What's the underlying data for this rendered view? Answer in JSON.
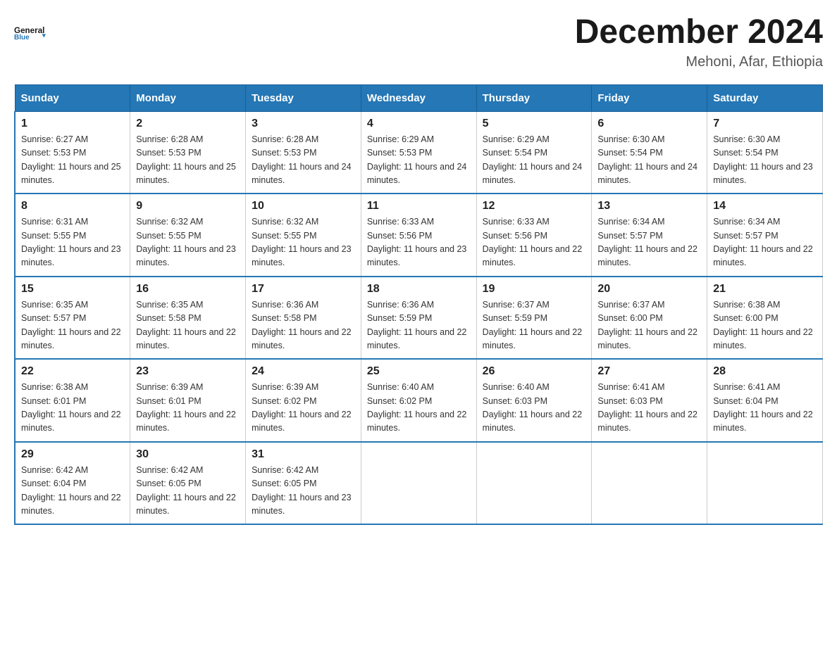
{
  "header": {
    "logo_general": "General",
    "logo_blue": "Blue",
    "month_year": "December 2024",
    "location": "Mehoni, Afar, Ethiopia"
  },
  "weekdays": [
    "Sunday",
    "Monday",
    "Tuesday",
    "Wednesday",
    "Thursday",
    "Friday",
    "Saturday"
  ],
  "weeks": [
    [
      {
        "day": "1",
        "sunrise": "6:27 AM",
        "sunset": "5:53 PM",
        "daylight": "11 hours and 25 minutes."
      },
      {
        "day": "2",
        "sunrise": "6:28 AM",
        "sunset": "5:53 PM",
        "daylight": "11 hours and 25 minutes."
      },
      {
        "day": "3",
        "sunrise": "6:28 AM",
        "sunset": "5:53 PM",
        "daylight": "11 hours and 24 minutes."
      },
      {
        "day": "4",
        "sunrise": "6:29 AM",
        "sunset": "5:53 PM",
        "daylight": "11 hours and 24 minutes."
      },
      {
        "day": "5",
        "sunrise": "6:29 AM",
        "sunset": "5:54 PM",
        "daylight": "11 hours and 24 minutes."
      },
      {
        "day": "6",
        "sunrise": "6:30 AM",
        "sunset": "5:54 PM",
        "daylight": "11 hours and 24 minutes."
      },
      {
        "day": "7",
        "sunrise": "6:30 AM",
        "sunset": "5:54 PM",
        "daylight": "11 hours and 23 minutes."
      }
    ],
    [
      {
        "day": "8",
        "sunrise": "6:31 AM",
        "sunset": "5:55 PM",
        "daylight": "11 hours and 23 minutes."
      },
      {
        "day": "9",
        "sunrise": "6:32 AM",
        "sunset": "5:55 PM",
        "daylight": "11 hours and 23 minutes."
      },
      {
        "day": "10",
        "sunrise": "6:32 AM",
        "sunset": "5:55 PM",
        "daylight": "11 hours and 23 minutes."
      },
      {
        "day": "11",
        "sunrise": "6:33 AM",
        "sunset": "5:56 PM",
        "daylight": "11 hours and 23 minutes."
      },
      {
        "day": "12",
        "sunrise": "6:33 AM",
        "sunset": "5:56 PM",
        "daylight": "11 hours and 22 minutes."
      },
      {
        "day": "13",
        "sunrise": "6:34 AM",
        "sunset": "5:57 PM",
        "daylight": "11 hours and 22 minutes."
      },
      {
        "day": "14",
        "sunrise": "6:34 AM",
        "sunset": "5:57 PM",
        "daylight": "11 hours and 22 minutes."
      }
    ],
    [
      {
        "day": "15",
        "sunrise": "6:35 AM",
        "sunset": "5:57 PM",
        "daylight": "11 hours and 22 minutes."
      },
      {
        "day": "16",
        "sunrise": "6:35 AM",
        "sunset": "5:58 PM",
        "daylight": "11 hours and 22 minutes."
      },
      {
        "day": "17",
        "sunrise": "6:36 AM",
        "sunset": "5:58 PM",
        "daylight": "11 hours and 22 minutes."
      },
      {
        "day": "18",
        "sunrise": "6:36 AM",
        "sunset": "5:59 PM",
        "daylight": "11 hours and 22 minutes."
      },
      {
        "day": "19",
        "sunrise": "6:37 AM",
        "sunset": "5:59 PM",
        "daylight": "11 hours and 22 minutes."
      },
      {
        "day": "20",
        "sunrise": "6:37 AM",
        "sunset": "6:00 PM",
        "daylight": "11 hours and 22 minutes."
      },
      {
        "day": "21",
        "sunrise": "6:38 AM",
        "sunset": "6:00 PM",
        "daylight": "11 hours and 22 minutes."
      }
    ],
    [
      {
        "day": "22",
        "sunrise": "6:38 AM",
        "sunset": "6:01 PM",
        "daylight": "11 hours and 22 minutes."
      },
      {
        "day": "23",
        "sunrise": "6:39 AM",
        "sunset": "6:01 PM",
        "daylight": "11 hours and 22 minutes."
      },
      {
        "day": "24",
        "sunrise": "6:39 AM",
        "sunset": "6:02 PM",
        "daylight": "11 hours and 22 minutes."
      },
      {
        "day": "25",
        "sunrise": "6:40 AM",
        "sunset": "6:02 PM",
        "daylight": "11 hours and 22 minutes."
      },
      {
        "day": "26",
        "sunrise": "6:40 AM",
        "sunset": "6:03 PM",
        "daylight": "11 hours and 22 minutes."
      },
      {
        "day": "27",
        "sunrise": "6:41 AM",
        "sunset": "6:03 PM",
        "daylight": "11 hours and 22 minutes."
      },
      {
        "day": "28",
        "sunrise": "6:41 AM",
        "sunset": "6:04 PM",
        "daylight": "11 hours and 22 minutes."
      }
    ],
    [
      {
        "day": "29",
        "sunrise": "6:42 AM",
        "sunset": "6:04 PM",
        "daylight": "11 hours and 22 minutes."
      },
      {
        "day": "30",
        "sunrise": "6:42 AM",
        "sunset": "6:05 PM",
        "daylight": "11 hours and 22 minutes."
      },
      {
        "day": "31",
        "sunrise": "6:42 AM",
        "sunset": "6:05 PM",
        "daylight": "11 hours and 23 minutes."
      },
      null,
      null,
      null,
      null
    ]
  ],
  "labels": {
    "sunrise": "Sunrise:",
    "sunset": "Sunset:",
    "daylight": "Daylight:"
  }
}
